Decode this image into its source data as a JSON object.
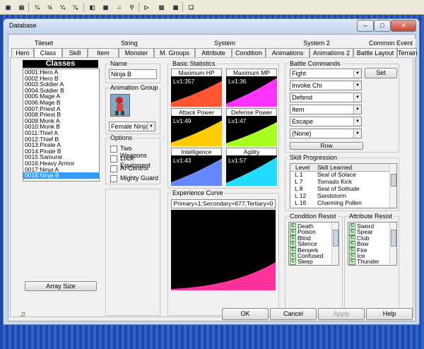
{
  "toolbar": {
    "buttons": [
      {
        "name": "new-project-icon",
        "glyph": "▣"
      },
      {
        "name": "open-project-icon",
        "glyph": "▤"
      },
      {
        "name": "layer-1-icon",
        "glyph": "¼"
      },
      {
        "name": "layer-2-icon",
        "glyph": "½"
      },
      {
        "name": "layer-3-icon",
        "glyph": "¼"
      },
      {
        "name": "layer-4-icon",
        "glyph": "⅛"
      },
      {
        "name": "database-icon",
        "glyph": "◧"
      },
      {
        "name": "resource-icon",
        "glyph": "▦"
      },
      {
        "name": "sound-icon",
        "glyph": "♫"
      },
      {
        "name": "search-icon",
        "glyph": "⚲"
      },
      {
        "name": "playtest-icon",
        "glyph": "▷"
      },
      {
        "name": "fullscreen-icon",
        "glyph": "▨"
      },
      {
        "name": "title-icon",
        "glyph": "▩"
      },
      {
        "name": "help-book-icon",
        "glyph": "❏"
      }
    ]
  },
  "window": {
    "title": "Database",
    "minimize": "–",
    "maximize": "□",
    "close": "✕"
  },
  "tabs_top": [
    "Tileset",
    "String",
    "System",
    "System 2",
    "Common Event"
  ],
  "tabs_bottom": [
    "Hero",
    "Class",
    "Skill",
    "Item",
    "Monster",
    "M. Groups",
    "Attribute",
    "Condition",
    "Animations",
    "Animations 2",
    "Battle Layout",
    "Terrain"
  ],
  "classes": {
    "header": "Classes",
    "items": [
      "0001:Hero A",
      "0002:Hero B",
      "0003:Soldier A",
      "0004:Soldier B",
      "0005:Mage A",
      "0006:Mage B",
      "0007:Priest A",
      "0008:Priest B",
      "0009:Monk A",
      "0010:Monk B",
      "0011:Thief A",
      "0012:Thief B",
      "0013:Pirate A",
      "0014:Pirate B",
      "0015:Samurai",
      "0016:Heavy Armor",
      "0017:Ninja A",
      "0018:Ninja B"
    ],
    "array_size": "Array Size"
  },
  "name_group": {
    "label": "Name",
    "value": "Ninja B"
  },
  "animation_group": {
    "label": "Animation Group",
    "value": "Female Ninja"
  },
  "options": {
    "label": "Options",
    "items": [
      "Two Weapons",
      "Lock Equipment",
      "AI Control",
      "Mighty Guard"
    ]
  },
  "basic_stats": {
    "label": "Basic Statistics",
    "stats": [
      {
        "name": "Maximum HP",
        "value": "Lv1:357",
        "color": "#ff5533"
      },
      {
        "name": "Maximum MP",
        "value": "Lv1:36",
        "color": "#ff33ff"
      },
      {
        "name": "Attack Power",
        "value": "Lv1:49",
        "color": "#ffcc00"
      },
      {
        "name": "Defense Power",
        "value": "Lv1:47",
        "color": "#aaff22"
      },
      {
        "name": "Intelligence",
        "value": "Lv1:43",
        "color": "#6688ff"
      },
      {
        "name": "Agility",
        "value": "Lv1:57",
        "color": "#22ddff"
      }
    ]
  },
  "experience": {
    "label": "Experience Curve",
    "text": "Primary=1;Secondary=677;Tertiary=0",
    "color": "#ff3399"
  },
  "battle_commands": {
    "label": "Battle Commands",
    "items": [
      "Fight",
      "Invoke Chi",
      "Defend",
      "Item",
      "Escape",
      "(None)"
    ],
    "set_button": "Set",
    "row_button": "Row"
  },
  "skill_progression": {
    "label": "Skill Progression",
    "headers": [
      "Level",
      "Skill Learned"
    ],
    "rows": [
      {
        "level": "L  1",
        "skill": "Seal of Solace"
      },
      {
        "level": "L  7",
        "skill": "Tornado Kick"
      },
      {
        "level": "L  8",
        "skill": "Seal of Solitude"
      },
      {
        "level": "L 12",
        "skill": "Sandstorm"
      },
      {
        "level": "L 16",
        "skill": "Charming Pollen"
      }
    ]
  },
  "condition_resist": {
    "label": "Condition Resist",
    "grade": "C",
    "items": [
      "Death",
      "Poison",
      "Blind",
      "Silence",
      "Berserk",
      "Confused",
      "Sleep"
    ]
  },
  "attribute_resist": {
    "label": "Attribute Resist",
    "grade": "C",
    "items": [
      "Sword",
      "Spear",
      "Club",
      "Bow",
      "Fire",
      "Ice",
      "Thunder"
    ]
  },
  "footer": {
    "ok": "OK",
    "cancel": "Cancel",
    "apply": "Apply",
    "help": "Help",
    "music_icon": "♫"
  }
}
